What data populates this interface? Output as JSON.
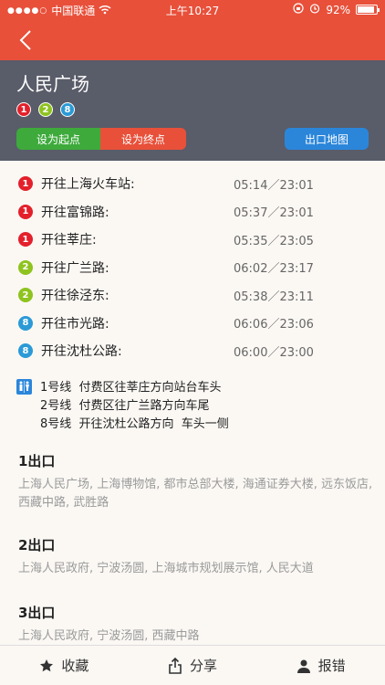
{
  "status_bar": {
    "signal": "●●●●○",
    "carrier": "中国联通",
    "time": "上午10:27",
    "battery": "92%",
    "battery_level": 0.92
  },
  "station": {
    "name": "人民广场",
    "lines": [
      {
        "label": "1",
        "color": "#e3202b"
      },
      {
        "label": "2",
        "color": "#8fc31f"
      },
      {
        "label": "8",
        "color": "#2b9ad6"
      }
    ]
  },
  "actions": {
    "set_start": "设为起点",
    "set_end": "设为终点",
    "exit_map": "出口地图"
  },
  "schedule": [
    {
      "line": "1",
      "color": "#e3202b",
      "dest": "开往上海火车站:",
      "time": "05:14／23:01"
    },
    {
      "line": "1",
      "color": "#e3202b",
      "dest": "开往富锦路:",
      "time": "05:37／23:01"
    },
    {
      "line": "1",
      "color": "#e3202b",
      "dest": "开往莘庄:",
      "time": "05:35／23:05"
    },
    {
      "line": "2",
      "color": "#8fc31f",
      "dest": "开往广兰路:",
      "time": "06:02／23:17"
    },
    {
      "line": "2",
      "color": "#8fc31f",
      "dest": "开往徐泾东:",
      "time": "05:38／23:11"
    },
    {
      "line": "8",
      "color": "#2b9ad6",
      "dest": "开往市光路:",
      "time": "06:06／23:06"
    },
    {
      "line": "8",
      "color": "#2b9ad6",
      "dest": "开往沈杜公路:",
      "time": "06:00／23:00"
    }
  ],
  "restroom": [
    "1号线  付费区往莘庄方向站台车头",
    "2号线  付费区往广兰路方向车尾",
    "8号线  开往沈杜公路方向  车头一侧"
  ],
  "exits": [
    {
      "title": "1出口",
      "desc": "上海人民广场, 上海博物馆, 都市总部大楼, 海通证券大楼, 远东饭店, 西藏中路, 武胜路"
    },
    {
      "title": "2出口",
      "desc": "上海人民政府, 宁波汤圆, 上海城市规划展示馆, 人民大道"
    },
    {
      "title": "3出口",
      "desc": "上海人民政府, 宁波汤圆, 西藏中路"
    }
  ],
  "tabs": {
    "favorite": "收藏",
    "share": "分享",
    "report": "报错"
  }
}
